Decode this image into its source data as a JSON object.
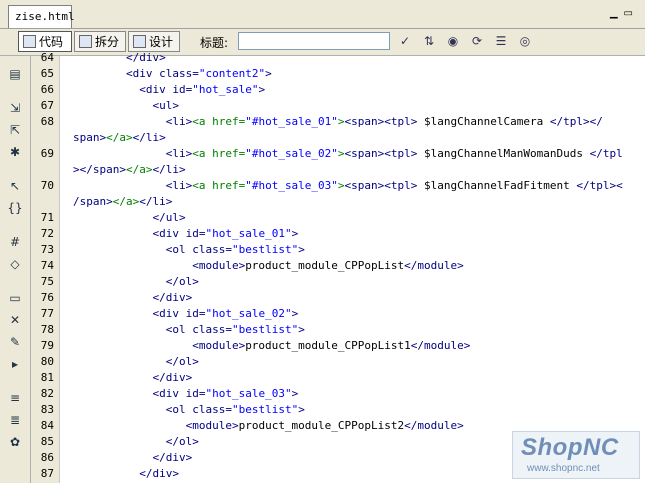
{
  "tab": {
    "filename": "zise.html"
  },
  "window": {
    "minimize_label": "▁",
    "restore_label": "▭"
  },
  "toolbar": {
    "code_label": "代码",
    "split_label": "拆分",
    "design_label": "设计",
    "title_label": "标题:",
    "title_value": ""
  },
  "code": {
    "lines": [
      {
        "n": "64",
        "segments": [
          {
            "t": "        </div>",
            "c": "k"
          }
        ]
      },
      {
        "n": "65",
        "segments": [
          {
            "t": "        <div ",
            "c": "k"
          },
          {
            "t": "class=",
            "c": "a"
          },
          {
            "t": "\"content2\"",
            "c": "v"
          },
          {
            "t": ">",
            "c": "k"
          }
        ]
      },
      {
        "n": "66",
        "segments": [
          {
            "t": "          <div ",
            "c": "k"
          },
          {
            "t": "id=",
            "c": "a"
          },
          {
            "t": "\"hot_sale\"",
            "c": "v"
          },
          {
            "t": ">",
            "c": "k"
          }
        ]
      },
      {
        "n": "67",
        "segments": [
          {
            "t": "            <ul>",
            "c": "k"
          }
        ]
      },
      {
        "n": "68",
        "segments": [
          {
            "t": "              <li>",
            "c": "k"
          },
          {
            "t": "<a href=",
            "c": "gr"
          },
          {
            "t": "\"#hot_sale_01\"",
            "c": "v"
          },
          {
            "t": ">",
            "c": "gr"
          },
          {
            "t": "<span><tpl>",
            "c": "k"
          },
          {
            "t": " $langChannelCamera ",
            "c": "tx"
          },
          {
            "t": "</tpl></",
            "c": "k"
          }
        ]
      },
      {
        "n": "",
        "segments": [
          {
            "t": "span>",
            "c": "k"
          },
          {
            "t": "</a>",
            "c": "gr"
          },
          {
            "t": "</li>",
            "c": "k"
          }
        ]
      },
      {
        "n": "69",
        "segments": [
          {
            "t": "              <li>",
            "c": "k"
          },
          {
            "t": "<a href=",
            "c": "gr"
          },
          {
            "t": "\"#hot_sale_02\"",
            "c": "v"
          },
          {
            "t": ">",
            "c": "gr"
          },
          {
            "t": "<span><tpl>",
            "c": "k"
          },
          {
            "t": " $langChannelManWomanDuds ",
            "c": "tx"
          },
          {
            "t": "</tpl",
            "c": "k"
          }
        ]
      },
      {
        "n": "",
        "segments": [
          {
            "t": "></span>",
            "c": "k"
          },
          {
            "t": "</a>",
            "c": "gr"
          },
          {
            "t": "</li>",
            "c": "k"
          }
        ]
      },
      {
        "n": "70",
        "segments": [
          {
            "t": "              <li>",
            "c": "k"
          },
          {
            "t": "<a href=",
            "c": "gr"
          },
          {
            "t": "\"#hot_sale_03\"",
            "c": "v"
          },
          {
            "t": ">",
            "c": "gr"
          },
          {
            "t": "<span><tpl>",
            "c": "k"
          },
          {
            "t": " $langChannelFadFitment ",
            "c": "tx"
          },
          {
            "t": "</tpl><",
            "c": "k"
          }
        ]
      },
      {
        "n": "",
        "segments": [
          {
            "t": "/span>",
            "c": "k"
          },
          {
            "t": "</a>",
            "c": "gr"
          },
          {
            "t": "</li>",
            "c": "k"
          }
        ]
      },
      {
        "n": "71",
        "segments": [
          {
            "t": "            </ul>",
            "c": "k"
          }
        ]
      },
      {
        "n": "72",
        "segments": [
          {
            "t": "            <div ",
            "c": "k"
          },
          {
            "t": "id=",
            "c": "a"
          },
          {
            "t": "\"hot_sale_01\"",
            "c": "v"
          },
          {
            "t": ">",
            "c": "k"
          }
        ]
      },
      {
        "n": "73",
        "segments": [
          {
            "t": "              <ol ",
            "c": "k"
          },
          {
            "t": "class=",
            "c": "a"
          },
          {
            "t": "\"bestlist\"",
            "c": "v"
          },
          {
            "t": ">",
            "c": "k"
          }
        ]
      },
      {
        "n": "74",
        "segments": [
          {
            "t": "                  <module>",
            "c": "k"
          },
          {
            "t": "product_module_CPPopList",
            "c": "tx"
          },
          {
            "t": "</module>",
            "c": "k"
          }
        ]
      },
      {
        "n": "75",
        "segments": [
          {
            "t": "              </ol>",
            "c": "k"
          }
        ]
      },
      {
        "n": "76",
        "segments": [
          {
            "t": "            </div>",
            "c": "k"
          }
        ]
      },
      {
        "n": "77",
        "segments": [
          {
            "t": "            <div ",
            "c": "k"
          },
          {
            "t": "id=",
            "c": "a"
          },
          {
            "t": "\"hot_sale_02\"",
            "c": "v"
          },
          {
            "t": ">",
            "c": "k"
          }
        ]
      },
      {
        "n": "78",
        "segments": [
          {
            "t": "              <ol ",
            "c": "k"
          },
          {
            "t": "class=",
            "c": "a"
          },
          {
            "t": "\"bestlist\"",
            "c": "v"
          },
          {
            "t": ">",
            "c": "k"
          }
        ]
      },
      {
        "n": "79",
        "segments": [
          {
            "t": "                  <module>",
            "c": "k"
          },
          {
            "t": "product_module_CPPopList1",
            "c": "tx"
          },
          {
            "t": "</module>",
            "c": "k"
          }
        ]
      },
      {
        "n": "80",
        "segments": [
          {
            "t": "              </ol>",
            "c": "k"
          }
        ]
      },
      {
        "n": "81",
        "segments": [
          {
            "t": "            </div>",
            "c": "k"
          }
        ]
      },
      {
        "n": "82",
        "segments": [
          {
            "t": "            <div ",
            "c": "k"
          },
          {
            "t": "id=",
            "c": "a"
          },
          {
            "t": "\"hot_sale_03\"",
            "c": "v"
          },
          {
            "t": ">",
            "c": "k"
          }
        ]
      },
      {
        "n": "83",
        "segments": [
          {
            "t": "              <ol ",
            "c": "k"
          },
          {
            "t": "class=",
            "c": "a"
          },
          {
            "t": "\"bestlist\"",
            "c": "v"
          },
          {
            "t": ">",
            "c": "k"
          }
        ]
      },
      {
        "n": "84",
        "segments": [
          {
            "t": "                 <module>",
            "c": "k"
          },
          {
            "t": "product_module_CPPopList2",
            "c": "tx"
          },
          {
            "t": "</module>",
            "c": "k"
          }
        ]
      },
      {
        "n": "85",
        "segments": [
          {
            "t": "              </ol>",
            "c": "k"
          }
        ]
      },
      {
        "n": "86",
        "segments": [
          {
            "t": "            </div>",
            "c": "k"
          }
        ]
      },
      {
        "n": "87",
        "segments": [
          {
            "t": "          </div>",
            "c": "k"
          }
        ]
      }
    ]
  },
  "watermark": {
    "brand": "ShopNC",
    "url": "www.shopnc.net"
  },
  "colors": {
    "tag": "#000080",
    "value": "#0000ff",
    "link": "#008000",
    "text": "#000000"
  }
}
